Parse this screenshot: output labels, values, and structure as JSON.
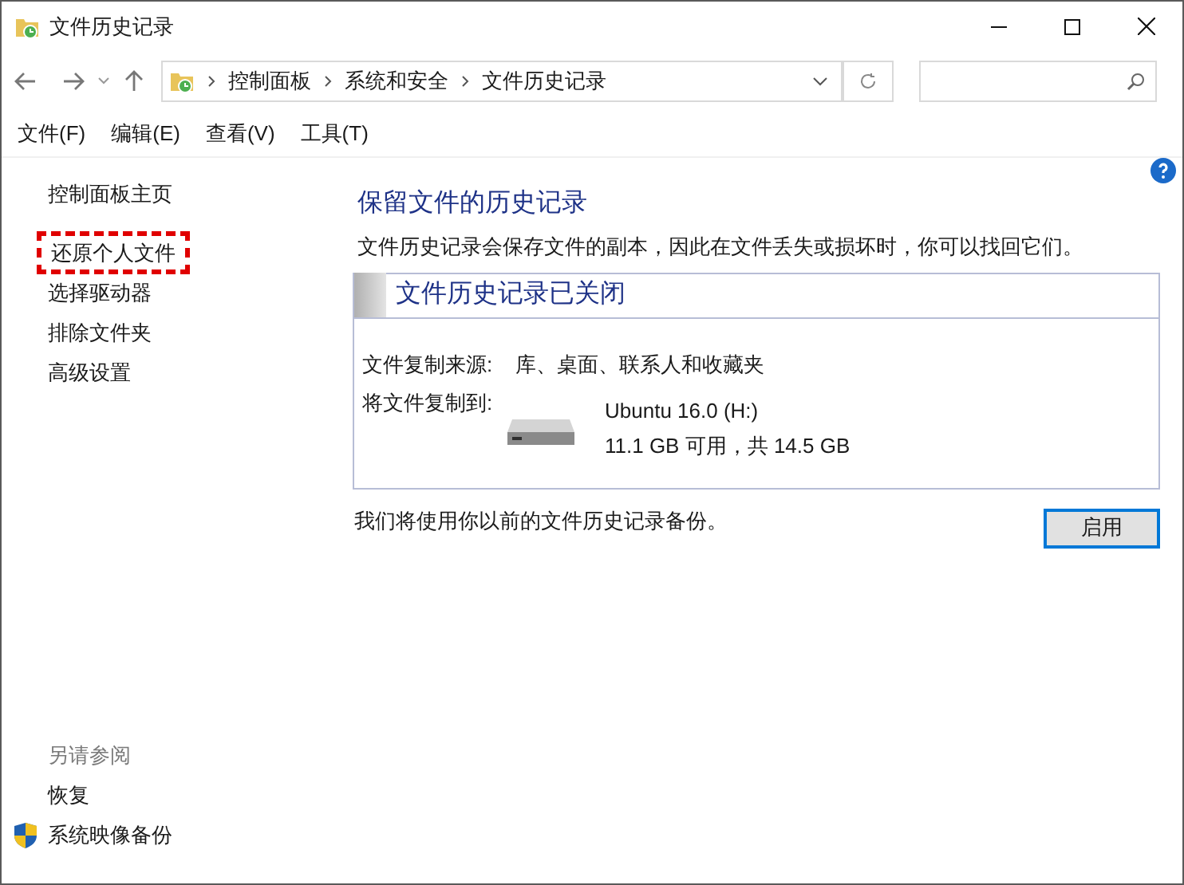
{
  "window": {
    "title": "文件历史记录"
  },
  "address_bar": {
    "breadcrumbs": [
      "控制面板",
      "系统和安全",
      "文件历史记录"
    ]
  },
  "menu": [
    "文件(F)",
    "编辑(E)",
    "查看(V)",
    "工具(T)"
  ],
  "sidebar": {
    "items": [
      {
        "label": "控制面板主页",
        "highlighted": false
      },
      {
        "label": "还原个人文件",
        "highlighted": true
      },
      {
        "label": "选择驱动器",
        "highlighted": false
      },
      {
        "label": "排除文件夹",
        "highlighted": false
      },
      {
        "label": "高级设置",
        "highlighted": false
      }
    ],
    "see_also": {
      "heading": "另请参阅",
      "items": [
        {
          "label": "恢复",
          "kind": "plain"
        },
        {
          "label": "系统映像备份",
          "kind": "shield"
        }
      ]
    }
  },
  "main": {
    "title": "保留文件的历史记录",
    "description": "文件历史记录会保存文件的副本，因此在文件丢失或损坏时，你可以找回它们。",
    "status_panel": {
      "heading": "文件历史记录已关闭",
      "source_label": "文件复制来源:",
      "source_value": "库、桌面、联系人和收藏夹",
      "target_label": "将文件复制到:",
      "drive_name": "Ubuntu 16.0 (H:)",
      "drive_space": "11.1 GB 可用，共 14.5 GB"
    },
    "note": "我们将使用你以前的文件历史记录备份。",
    "button": "启用"
  }
}
